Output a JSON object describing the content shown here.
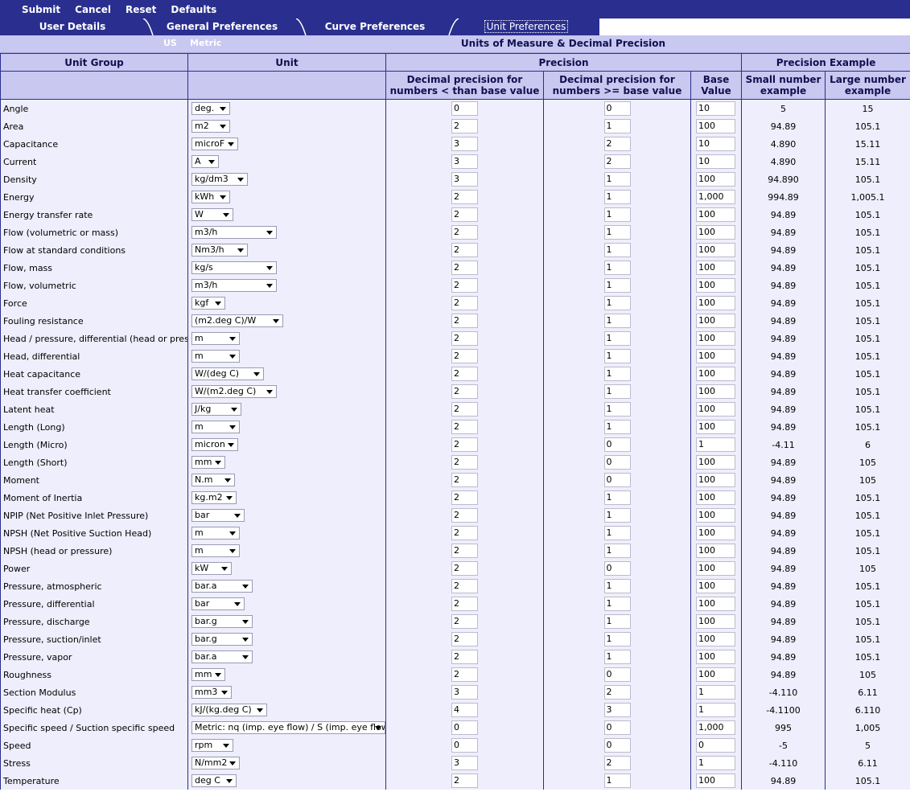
{
  "toolbar": {
    "submit": "Submit",
    "cancel": "Cancel",
    "reset": "Reset",
    "defaults": "Defaults"
  },
  "tabs": {
    "user": "User Details",
    "general": "General Preferences",
    "curve": "Curve Preferences",
    "unit": "Unit Preferences"
  },
  "unitbar": {
    "us": "US",
    "metric": "Metric",
    "title": "Units of Measure & Decimal Precision"
  },
  "headers": {
    "unit_group": "Unit Group",
    "unit": "Unit",
    "precision": "Precision",
    "precision_example": "Precision Example",
    "dec_lt": "Decimal precision for numbers < than base value",
    "dec_ge": "Decimal precision for numbers >= base value",
    "base": "Base Value",
    "small": "Small number example",
    "large": "Large number example"
  },
  "rows": [
    {
      "group": "Angle",
      "unit": "deg.",
      "lt": "0",
      "ge": "0",
      "base": "10",
      "small": "5",
      "large": "15"
    },
    {
      "group": "Area",
      "unit": "m2",
      "lt": "2",
      "ge": "1",
      "base": "100",
      "small": "94.89",
      "large": "105.1"
    },
    {
      "group": "Capacitance",
      "unit": "microF",
      "lt": "3",
      "ge": "2",
      "base": "10",
      "small": "4.890",
      "large": "15.11"
    },
    {
      "group": "Current",
      "unit": "A",
      "lt": "3",
      "ge": "2",
      "base": "10",
      "small": "4.890",
      "large": "15.11"
    },
    {
      "group": "Density",
      "unit": "kg/dm3",
      "lt": "3",
      "ge": "1",
      "base": "100",
      "small": "94.890",
      "large": "105.1"
    },
    {
      "group": "Energy",
      "unit": "kWh",
      "lt": "2",
      "ge": "1",
      "base": "1,000",
      "small": "994.89",
      "large": "1,005.1"
    },
    {
      "group": "Energy transfer rate",
      "unit": "W",
      "lt": "2",
      "ge": "1",
      "base": "100",
      "small": "94.89",
      "large": "105.1"
    },
    {
      "group": "Flow (volumetric or mass)",
      "unit": "m3/h",
      "lt": "2",
      "ge": "1",
      "base": "100",
      "small": "94.89",
      "large": "105.1"
    },
    {
      "group": "Flow at standard conditions",
      "unit": "Nm3/h",
      "lt": "2",
      "ge": "1",
      "base": "100",
      "small": "94.89",
      "large": "105.1"
    },
    {
      "group": "Flow, mass",
      "unit": "kg/s",
      "lt": "2",
      "ge": "1",
      "base": "100",
      "small": "94.89",
      "large": "105.1"
    },
    {
      "group": "Flow, volumetric",
      "unit": "m3/h",
      "lt": "2",
      "ge": "1",
      "base": "100",
      "small": "94.89",
      "large": "105.1"
    },
    {
      "group": "Force",
      "unit": "kgf",
      "lt": "2",
      "ge": "1",
      "base": "100",
      "small": "94.89",
      "large": "105.1"
    },
    {
      "group": "Fouling resistance",
      "unit": "(m2.deg C)/W",
      "lt": "2",
      "ge": "1",
      "base": "100",
      "small": "94.89",
      "large": "105.1"
    },
    {
      "group": "Head / pressure, differential (head or pressure)",
      "unit": "m",
      "lt": "2",
      "ge": "1",
      "base": "100",
      "small": "94.89",
      "large": "105.1"
    },
    {
      "group": "Head, differential",
      "unit": "m",
      "lt": "2",
      "ge": "1",
      "base": "100",
      "small": "94.89",
      "large": "105.1"
    },
    {
      "group": "Heat capacitance",
      "unit": "W/(deg C)",
      "lt": "2",
      "ge": "1",
      "base": "100",
      "small": "94.89",
      "large": "105.1"
    },
    {
      "group": "Heat transfer coefficient",
      "unit": "W/(m2.deg C)",
      "lt": "2",
      "ge": "1",
      "base": "100",
      "small": "94.89",
      "large": "105.1"
    },
    {
      "group": "Latent heat",
      "unit": "J/kg",
      "lt": "2",
      "ge": "1",
      "base": "100",
      "small": "94.89",
      "large": "105.1"
    },
    {
      "group": "Length (Long)",
      "unit": "m",
      "lt": "2",
      "ge": "1",
      "base": "100",
      "small": "94.89",
      "large": "105.1"
    },
    {
      "group": "Length (Micro)",
      "unit": "micron",
      "lt": "2",
      "ge": "0",
      "base": "1",
      "small": "-4.11",
      "large": "6"
    },
    {
      "group": "Length (Short)",
      "unit": "mm",
      "lt": "2",
      "ge": "0",
      "base": "100",
      "small": "94.89",
      "large": "105"
    },
    {
      "group": "Moment",
      "unit": "N.m",
      "lt": "2",
      "ge": "0",
      "base": "100",
      "small": "94.89",
      "large": "105"
    },
    {
      "group": "Moment of Inertia",
      "unit": "kg.m2",
      "lt": "2",
      "ge": "1",
      "base": "100",
      "small": "94.89",
      "large": "105.1"
    },
    {
      "group": "NPIP (Net Positive Inlet Pressure)",
      "unit": "bar",
      "lt": "2",
      "ge": "1",
      "base": "100",
      "small": "94.89",
      "large": "105.1"
    },
    {
      "group": "NPSH (Net Positive Suction Head)",
      "unit": "m",
      "lt": "2",
      "ge": "1",
      "base": "100",
      "small": "94.89",
      "large": "105.1"
    },
    {
      "group": "NPSH (head or pressure)",
      "unit": "m",
      "lt": "2",
      "ge": "1",
      "base": "100",
      "small": "94.89",
      "large": "105.1"
    },
    {
      "group": "Power",
      "unit": "kW",
      "lt": "2",
      "ge": "0",
      "base": "100",
      "small": "94.89",
      "large": "105"
    },
    {
      "group": "Pressure, atmospheric",
      "unit": "bar.a",
      "lt": "2",
      "ge": "1",
      "base": "100",
      "small": "94.89",
      "large": "105.1"
    },
    {
      "group": "Pressure, differential",
      "unit": "bar",
      "lt": "2",
      "ge": "1",
      "base": "100",
      "small": "94.89",
      "large": "105.1"
    },
    {
      "group": "Pressure, discharge",
      "unit": "bar.g",
      "lt": "2",
      "ge": "1",
      "base": "100",
      "small": "94.89",
      "large": "105.1"
    },
    {
      "group": "Pressure, suction/inlet",
      "unit": "bar.g",
      "lt": "2",
      "ge": "1",
      "base": "100",
      "small": "94.89",
      "large": "105.1"
    },
    {
      "group": "Pressure, vapor",
      "unit": "bar.a",
      "lt": "2",
      "ge": "1",
      "base": "100",
      "small": "94.89",
      "large": "105.1"
    },
    {
      "group": "Roughness",
      "unit": "mm",
      "lt": "2",
      "ge": "0",
      "base": "100",
      "small": "94.89",
      "large": "105"
    },
    {
      "group": "Section Modulus",
      "unit": "mm3",
      "lt": "3",
      "ge": "2",
      "base": "1",
      "small": "-4.110",
      "large": "6.11"
    },
    {
      "group": "Specific heat (Cp)",
      "unit": "kJ/(kg.deg C)",
      "lt": "4",
      "ge": "3",
      "base": "1",
      "small": "-4.1100",
      "large": "6.110"
    },
    {
      "group": "Specific speed / Suction specific speed",
      "unit": "Metric: nq (imp. eye flow) / S (imp. eye flow)",
      "lt": "0",
      "ge": "0",
      "base": "1,000",
      "small": "995",
      "large": "1,005"
    },
    {
      "group": "Speed",
      "unit": "rpm",
      "lt": "0",
      "ge": "0",
      "base": "0",
      "small": "-5",
      "large": "5"
    },
    {
      "group": "Stress",
      "unit": "N/mm2",
      "lt": "3",
      "ge": "2",
      "base": "1",
      "small": "-4.110",
      "large": "6.11"
    },
    {
      "group": "Temperature",
      "unit": "deg C",
      "lt": "2",
      "ge": "1",
      "base": "100",
      "small": "94.89",
      "large": "105.1"
    }
  ]
}
